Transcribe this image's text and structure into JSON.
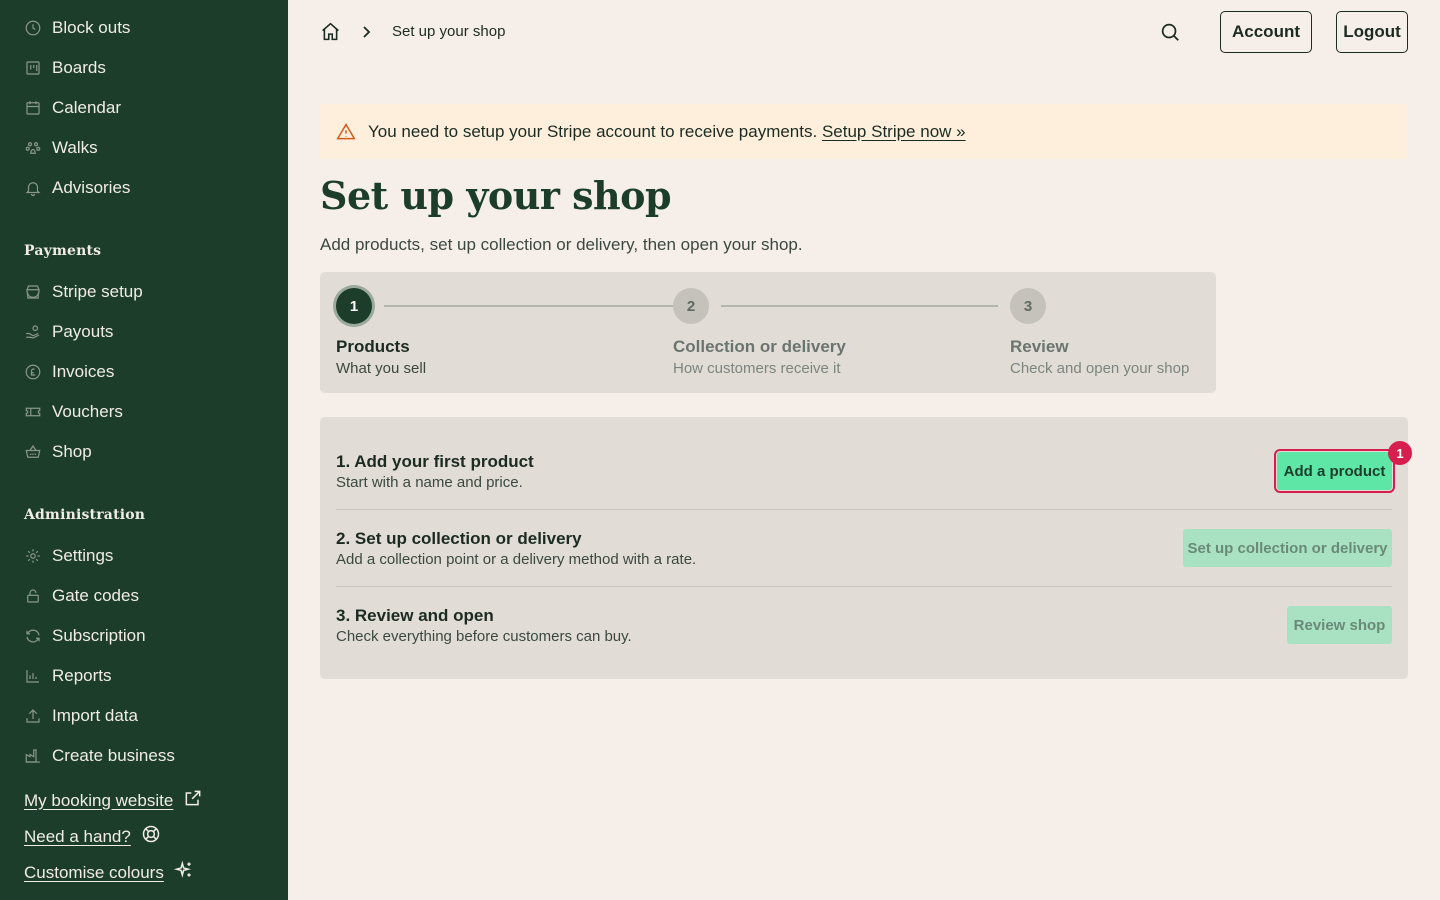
{
  "sidebar": {
    "items_top": [
      {
        "label": "Block outs",
        "icon": "clock-icon"
      },
      {
        "label": "Boards",
        "icon": "board-icon"
      },
      {
        "label": "Calendar",
        "icon": "calendar-icon"
      },
      {
        "label": "Walks",
        "icon": "paw-icon"
      },
      {
        "label": "Advisories",
        "icon": "bell-icon"
      }
    ],
    "payments_title": "Payments",
    "payments_items": [
      {
        "label": "Stripe setup",
        "icon": "store-icon"
      },
      {
        "label": "Payouts",
        "icon": "hand-coins-icon"
      },
      {
        "label": "Invoices",
        "icon": "pound-coin-icon"
      },
      {
        "label": "Vouchers",
        "icon": "ticket-icon"
      },
      {
        "label": "Shop",
        "icon": "basket-icon"
      }
    ],
    "admin_title": "Administration",
    "admin_items": [
      {
        "label": "Settings",
        "icon": "gear-icon"
      },
      {
        "label": "Gate codes",
        "icon": "lock-icon"
      },
      {
        "label": "Subscription",
        "icon": "refresh-icon"
      },
      {
        "label": "Reports",
        "icon": "bar-chart-icon"
      },
      {
        "label": "Import data",
        "icon": "upload-icon"
      },
      {
        "label": "Create business",
        "icon": "factory-icon"
      }
    ],
    "links": [
      {
        "label": "My booking website",
        "icon": "external-link-icon"
      },
      {
        "label": "Need a hand?",
        "icon": "lifebuoy-icon"
      },
      {
        "label": "Customise colours",
        "icon": "sparkles-icon"
      }
    ]
  },
  "header": {
    "breadcrumb_current": "Set up your shop",
    "account_label": "Account",
    "logout_label": "Logout"
  },
  "alert": {
    "message": "You need to setup your Stripe account to receive payments.",
    "link_label": "Setup Stripe now »"
  },
  "page": {
    "title": "Set up your shop",
    "subtitle": "Add products, set up collection or delivery, then open your shop."
  },
  "stepper": {
    "steps": [
      {
        "number": "1",
        "label": "Products",
        "desc": "What you sell",
        "active": true
      },
      {
        "number": "2",
        "label": "Collection or delivery",
        "desc": "How customers receive it",
        "active": false
      },
      {
        "number": "3",
        "label": "Review",
        "desc": "Check and open your shop",
        "active": false
      }
    ]
  },
  "tasks": [
    {
      "title": "1. Add your first product",
      "desc": "Start with a name and price.",
      "button": "Add a product",
      "badge": "1"
    },
    {
      "title": "2. Set up collection or delivery",
      "desc": "Add a collection point or a delivery method with a rate.",
      "button": "Set up collection or delivery"
    },
    {
      "title": "3. Review and open",
      "desc": "Check everything before customers can buy.",
      "button": "Review shop"
    }
  ],
  "colors": {
    "sidebar_bg": "#1b3d2a",
    "page_bg": "#f6efe9",
    "accent_green": "#5de6a5",
    "highlight_red": "#d61f4e",
    "warning_orange": "#d35a1a"
  }
}
